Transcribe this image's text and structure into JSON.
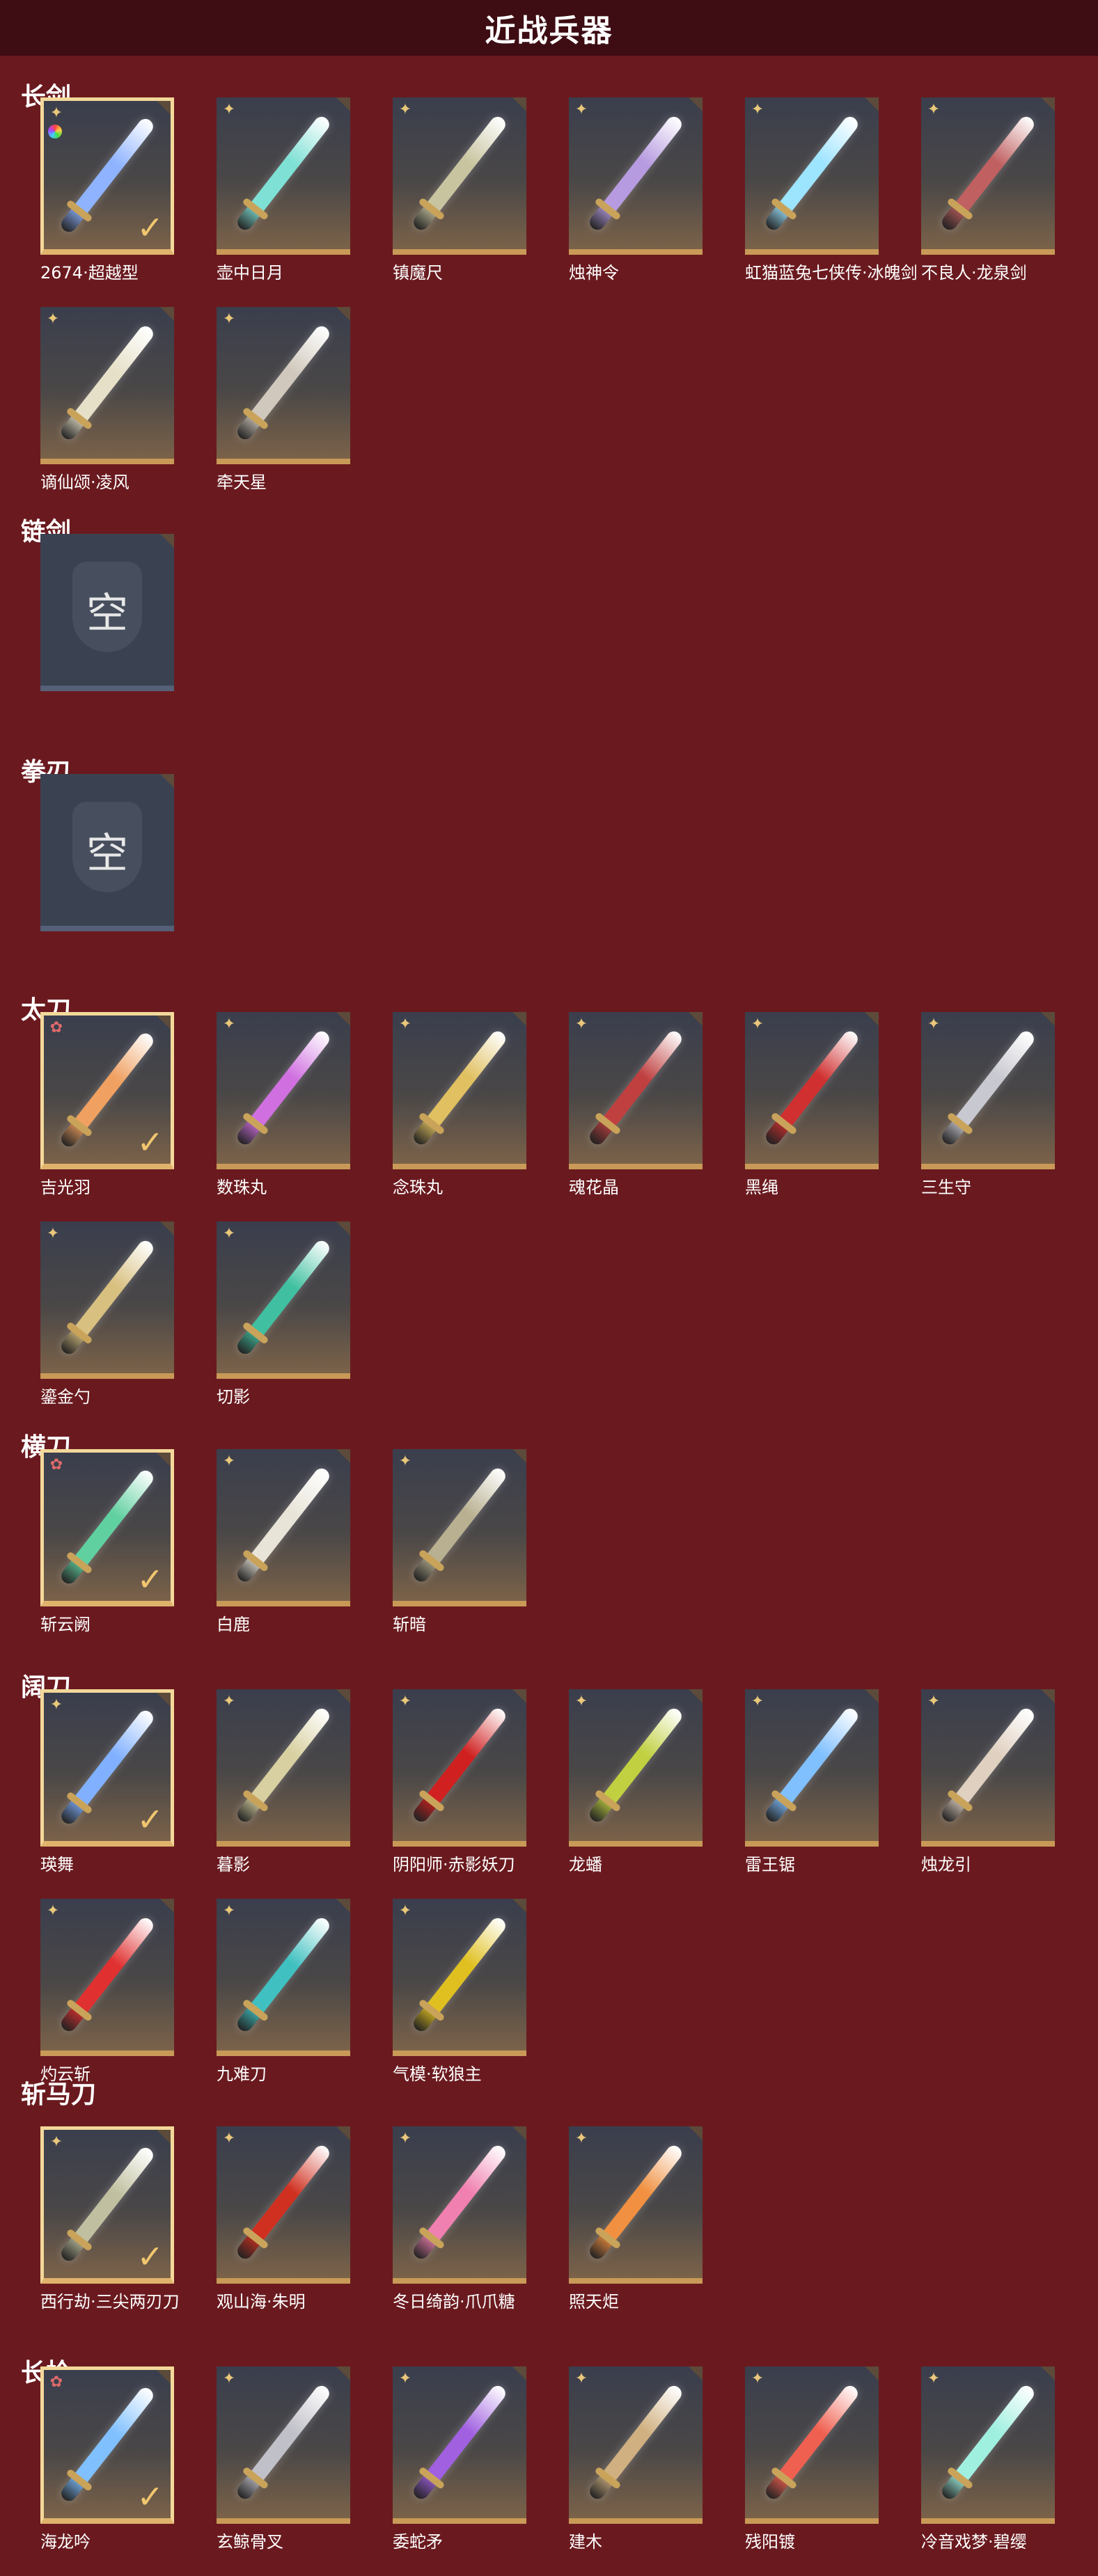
{
  "title": "近战兵器",
  "empty_label": "空",
  "icons": {
    "rank": "star-rank-icon",
    "check": "check-icon",
    "colorful": "color-ring-icon"
  },
  "sections": [
    {
      "title": "长剑",
      "items": [
        {
          "name": "2674·超越型",
          "rank": "gold",
          "selected": true,
          "colorful": true,
          "color": "#8fb3ff"
        },
        {
          "name": "壶中日月",
          "rank": "gold",
          "color": "#7fe0d5"
        },
        {
          "name": "镇魔尺",
          "rank": "gold",
          "color": "#c8c4a0"
        },
        {
          "name": "烛神令",
          "rank": "gold",
          "color": "#b79be0"
        },
        {
          "name": "虹猫蓝兔七侠传·冰魄剑",
          "rank": "gold",
          "color": "#9de4ff"
        },
        {
          "name": "不良人·龙泉剑",
          "rank": "gold",
          "color": "#c06060"
        },
        {
          "name": "谪仙颂·凌风",
          "rank": "gold",
          "color": "#e6e0c8"
        },
        {
          "name": "牵天星",
          "rank": "gold",
          "color": "#d0c8bc"
        }
      ]
    },
    {
      "title": "链剑",
      "items": [
        {
          "name": "",
          "empty": true
        }
      ]
    },
    {
      "title": "拳刃",
      "items": [
        {
          "name": "",
          "empty": true
        }
      ]
    },
    {
      "title": "太刀",
      "items": [
        {
          "name": "吉光羽",
          "rank": "red",
          "selected": true,
          "color": "#f0a060"
        },
        {
          "name": "数珠丸",
          "rank": "gold",
          "color": "#d070e0"
        },
        {
          "name": "念珠丸",
          "rank": "gold",
          "color": "#e0c060"
        },
        {
          "name": "魂花晶",
          "rank": "gold",
          "color": "#c04040"
        },
        {
          "name": "黑绳",
          "rank": "gold",
          "color": "#d03030"
        },
        {
          "name": "三生守",
          "rank": "gold",
          "color": "#c8c8d0"
        },
        {
          "name": "鎏金勺",
          "rank": "gold",
          "color": "#d8c080"
        },
        {
          "name": "切影",
          "rank": "gold",
          "color": "#40c0a0"
        }
      ]
    },
    {
      "title": "横刀",
      "items": [
        {
          "name": "斩云阙",
          "rank": "red",
          "selected": true,
          "color": "#60d0a0"
        },
        {
          "name": "白鹿",
          "rank": "gold",
          "color": "#e8e4d8"
        },
        {
          "name": "斩暗",
          "rank": "gold",
          "color": "#b8b090"
        }
      ]
    },
    {
      "title": "阔刀",
      "items": [
        {
          "name": "瑛舞",
          "rank": "gold",
          "selected": true,
          "color": "#80b0ff"
        },
        {
          "name": "暮影",
          "rank": "gold",
          "color": "#d8d0a0"
        },
        {
          "name": "阴阳师·赤影妖刀",
          "rank": "gold",
          "color": "#d02020"
        },
        {
          "name": "龙蟠",
          "rank": "gold",
          "color": "#c0d040"
        },
        {
          "name": "雷王锯",
          "rank": "gold",
          "color": "#80c0ff"
        },
        {
          "name": "烛龙引",
          "rank": "gold",
          "color": "#e0d0c0"
        },
        {
          "name": "灼云斩",
          "rank": "gold",
          "color": "#e03030"
        },
        {
          "name": "九难刀",
          "rank": "gold",
          "color": "#40c0c0"
        },
        {
          "name": "气模·软狼主",
          "rank": "gold",
          "color": "#e0c020"
        }
      ]
    },
    {
      "title": "斩马刀",
      "items": [
        {
          "name": "西行劫·三尖两刃刀",
          "rank": "gold",
          "selected": true,
          "color": "#c0c0a0"
        },
        {
          "name": "观山海·朱明",
          "rank": "gold",
          "color": "#d03020"
        },
        {
          "name": "冬日绮韵·爪爪糖",
          "rank": "gold",
          "color": "#f080b0"
        },
        {
          "name": "照天炬",
          "rank": "gold",
          "color": "#f09040"
        }
      ]
    },
    {
      "title": "长枪",
      "items": [
        {
          "name": "海龙吟",
          "rank": "red",
          "selected": true,
          "color": "#80c0ff"
        },
        {
          "name": "玄鲸骨叉",
          "rank": "gold",
          "color": "#c0c0c8"
        },
        {
          "name": "委蛇矛",
          "rank": "gold",
          "color": "#a060e0"
        },
        {
          "name": "建木",
          "rank": "gold",
          "color": "#d0b080"
        },
        {
          "name": "残阳镀",
          "rank": "gold",
          "color": "#f06050"
        },
        {
          "name": "冷音戏梦·碧缨",
          "rank": "gold",
          "color": "#a0f0e0"
        }
      ]
    }
  ]
}
